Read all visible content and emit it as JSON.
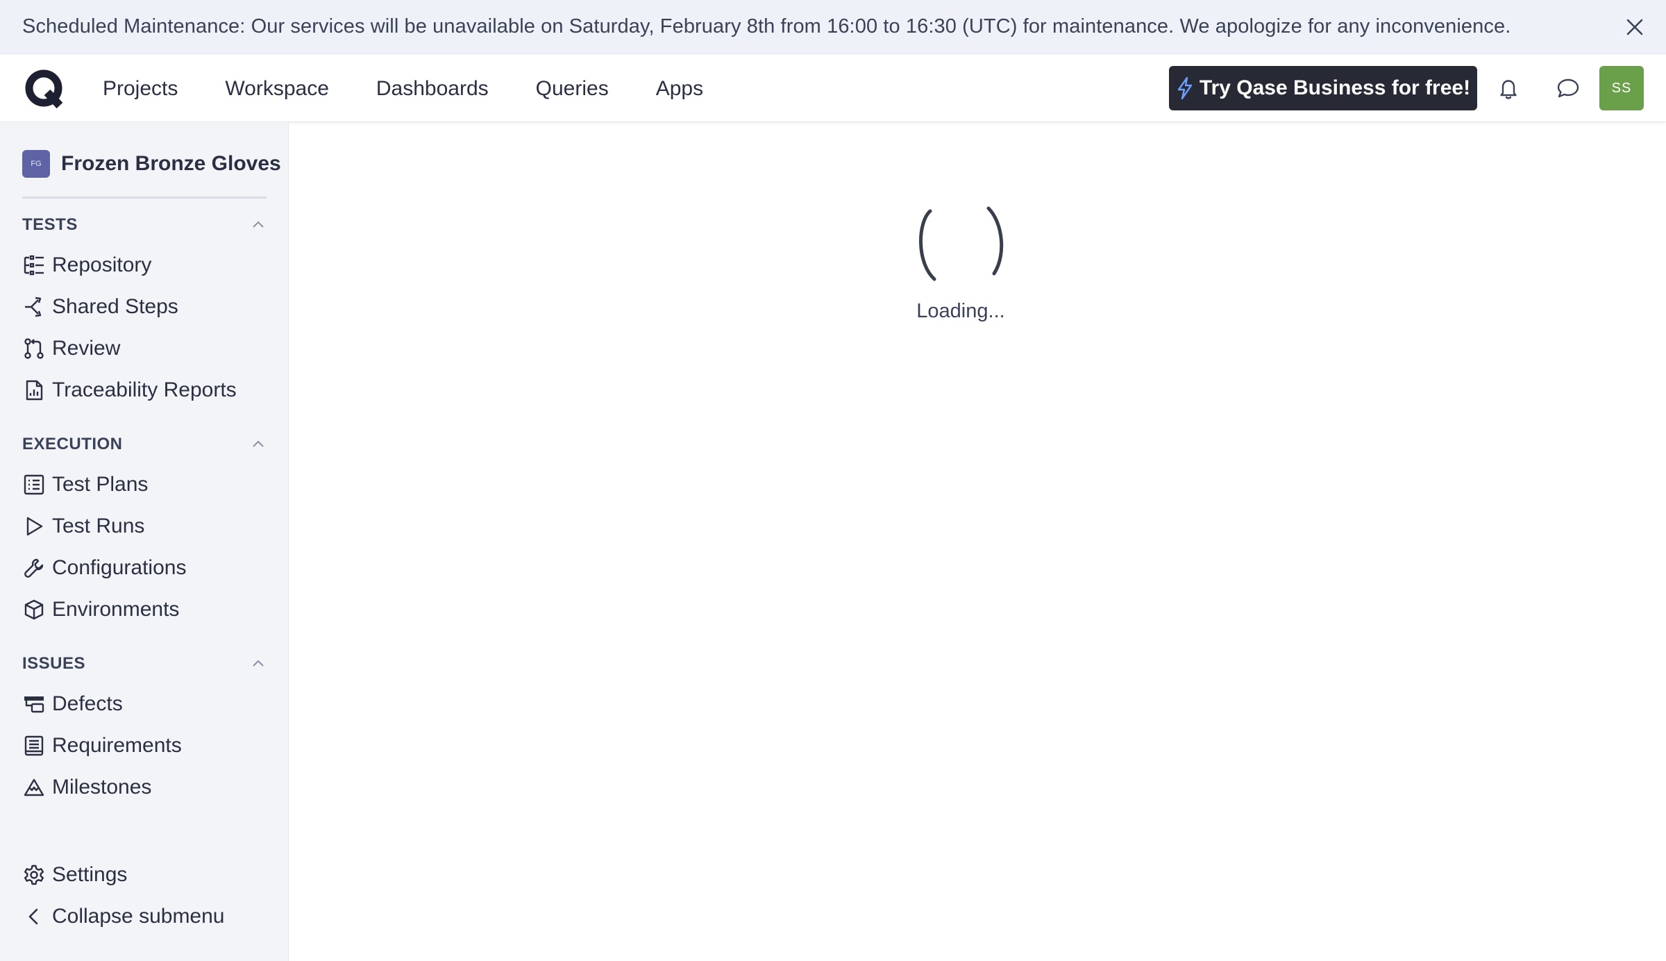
{
  "banner": {
    "text": "Scheduled Maintenance: Our services will be unavailable on Saturday, February 8th from 16:00 to 16:30 (UTC) for maintenance. We apologize for any inconvenience."
  },
  "topnav": {
    "items": [
      {
        "label": "Projects"
      },
      {
        "label": "Workspace"
      },
      {
        "label": "Dashboards"
      },
      {
        "label": "Queries"
      },
      {
        "label": "Apps"
      }
    ],
    "cta_label": "Try Qase Business for free!",
    "avatar_initials": "SS"
  },
  "sidebar": {
    "project_badge": "FG",
    "project_name": "Frozen Bronze Gloves",
    "sections": [
      {
        "title": "TESTS",
        "items": [
          {
            "label": "Repository",
            "icon": "repository-icon"
          },
          {
            "label": "Shared Steps",
            "icon": "shared-steps-icon"
          },
          {
            "label": "Review",
            "icon": "review-icon"
          },
          {
            "label": "Traceability Reports",
            "icon": "report-icon"
          }
        ]
      },
      {
        "title": "EXECUTION",
        "items": [
          {
            "label": "Test Plans",
            "icon": "test-plans-icon"
          },
          {
            "label": "Test Runs",
            "icon": "play-icon"
          },
          {
            "label": "Configurations",
            "icon": "wrench-icon"
          },
          {
            "label": "Environments",
            "icon": "cube-icon"
          }
        ]
      },
      {
        "title": "ISSUES",
        "items": [
          {
            "label": "Defects",
            "icon": "defects-icon"
          },
          {
            "label": "Requirements",
            "icon": "requirements-icon"
          },
          {
            "label": "Milestones",
            "icon": "milestone-icon"
          }
        ]
      }
    ],
    "settings_label": "Settings",
    "collapse_label": "Collapse submenu"
  },
  "main": {
    "loading_text": "Loading..."
  },
  "colors": {
    "banner_bg": "#eef1f8",
    "cta_bg": "#272a35",
    "avatar_bg": "#6aa04a",
    "project_badge_bg": "#5e63a6",
    "sidebar_bg": "#f3f4f7"
  }
}
